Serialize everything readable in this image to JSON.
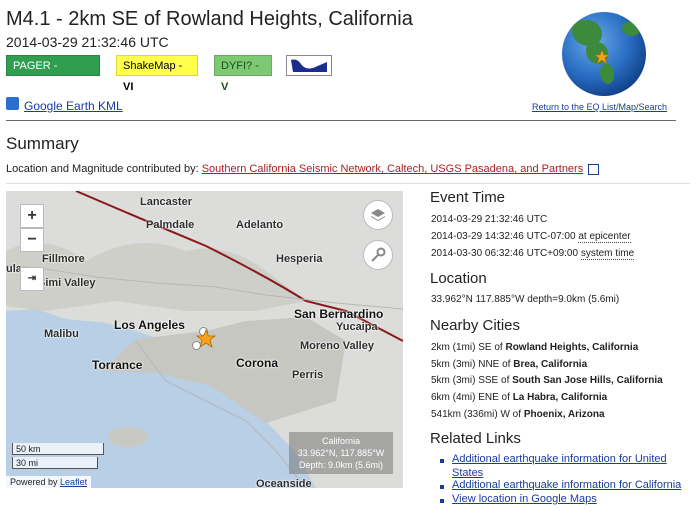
{
  "header": {
    "title": "M4.1 - 2km SE of Rowland Heights, California",
    "datetime": "2014-03-29 21:32:46 UTC"
  },
  "badges": [
    {
      "prefix": "PAGER - ",
      "value": "GREEN",
      "color": "#2f9e4e",
      "text_color": "#ffffff"
    },
    {
      "prefix": "ShakeMap - ",
      "value": "VI",
      "color": "#ffff4c",
      "text_color": "#000000"
    },
    {
      "prefix": "DYFI? - ",
      "value": "V",
      "color": "#7dc873",
      "text_color": "#1b4d1b"
    }
  ],
  "colors": {
    "link": "#1a3c9a",
    "contributor_link": "#b01e1e",
    "epicenter": "#f7a21b",
    "fault_line": "#8b1a1a"
  },
  "icons": [
    "dyfi-logo-icon",
    "globe-icon",
    "google-earth-icon",
    "layers-icon",
    "key-icon",
    "external-link-icon",
    "star-epicenter-icon"
  ],
  "links": {
    "google_earth": "Google Earth KML",
    "return": "Return to the EQ List/Map/Search"
  },
  "summary": {
    "heading": "Summary",
    "contrib_label": "Location and Magnitude contributed by:",
    "contrib_link": "Southern California Seismic Network, Caltech, USGS Pasadena, and Partners"
  },
  "map": {
    "zoom_in": "+",
    "zoom_out": "−",
    "labels": [
      "Lancaster",
      "Palmdale",
      "Adelanto",
      "Fillmore",
      "Hesperia",
      "Simi Valley",
      "Malibu",
      "Los Angeles",
      "San Bernardino",
      "Yucaipa",
      "Moreno Valley",
      "Torrance",
      "Corona",
      "Perris",
      "Oceanside"
    ],
    "label_fragments": {
      "left_edge": "ula"
    },
    "info_box": {
      "region": "California",
      "coords": "33.962°N, 117.885°W",
      "depth": "Depth: 9.0km (5.6mi)"
    },
    "scale": {
      "km": "50 km",
      "mi": "30 mi"
    },
    "attribution_prefix": "Powered by",
    "attribution_link": "Leaflet"
  },
  "event_time": {
    "heading": "Event Time",
    "utc": "2014-03-29 21:32:46 UTC",
    "local_prefix": "2014-03-29 14:32:46 UTC-07:00 ",
    "local_suffix": "at epicenter",
    "system_prefix": "2014-03-30 06:32:46 UTC+09:00 ",
    "system_suffix": "system time"
  },
  "location": {
    "heading": "Location",
    "value": "33.962°N 117.885°W depth=9.0km (5.6mi)"
  },
  "nearby_cities": {
    "heading": "Nearby Cities",
    "items": [
      {
        "prefix": "2km (1mi) SE of ",
        "place": "Rowland Heights, California"
      },
      {
        "prefix": "5km (3mi) NNE of ",
        "place": "Brea, California"
      },
      {
        "prefix": "5km (3mi) SSE of ",
        "place": "South San Jose Hills, California"
      },
      {
        "prefix": "6km (4mi) ENE of ",
        "place": "La Habra, California"
      },
      {
        "prefix": "541km (336mi) W of ",
        "place": "Phoenix, Arizona"
      }
    ]
  },
  "related_links": {
    "heading": "Related Links",
    "items": [
      {
        "line1": "Additional earthquake information for United",
        "line2": "States"
      },
      {
        "line1": "Additional earthquake information for California"
      },
      {
        "line1": "View location in Google Maps"
      }
    ]
  }
}
